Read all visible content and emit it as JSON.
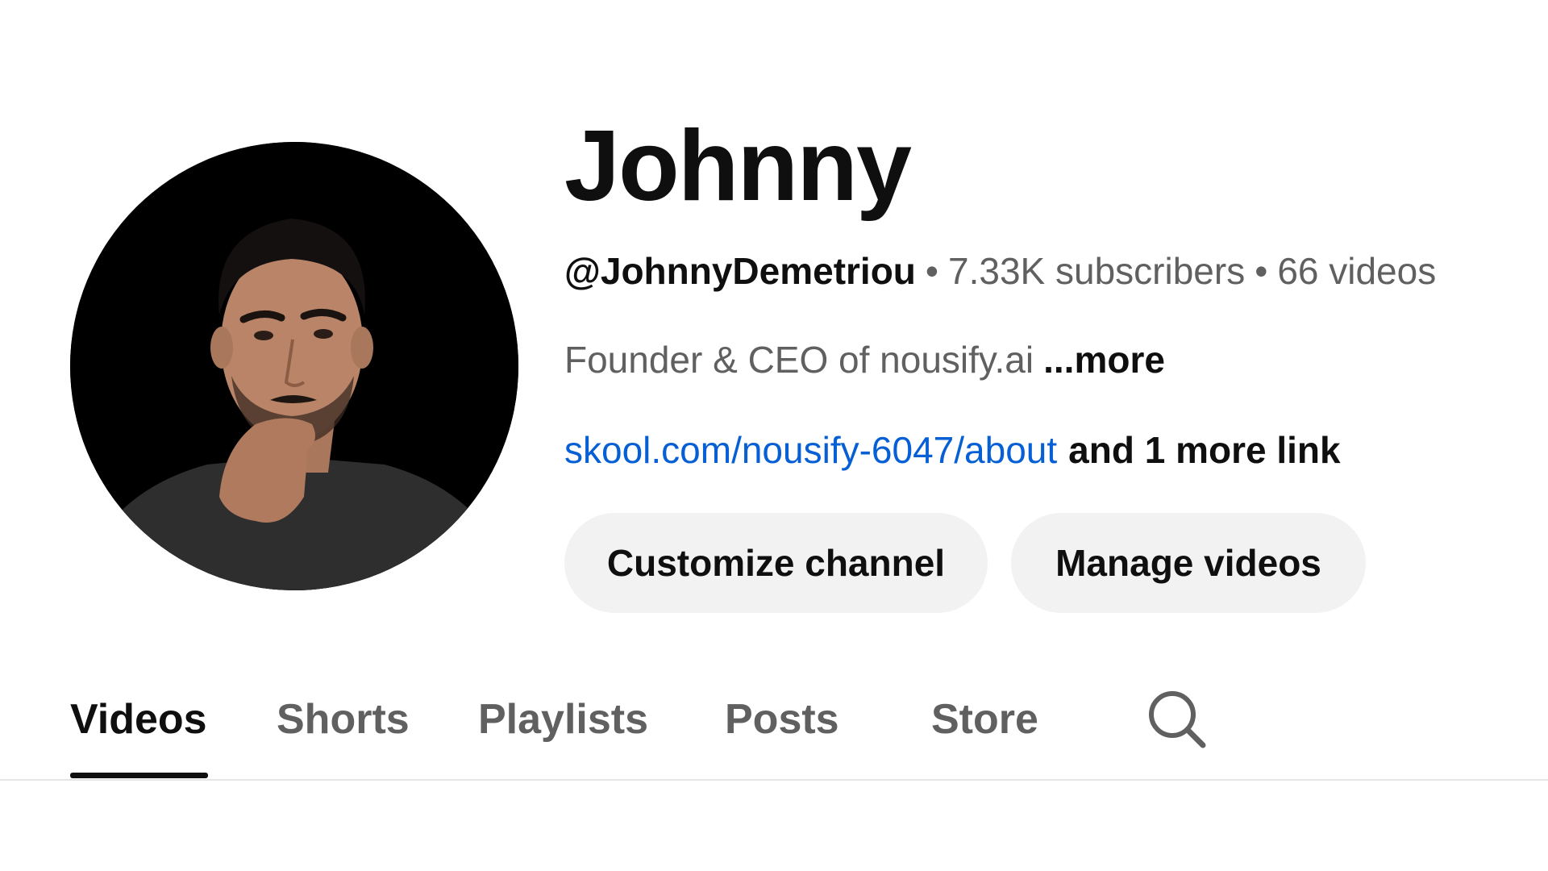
{
  "channel": {
    "name": "Johnny",
    "handle": "@JohnnyDemetriou",
    "separator": "•",
    "subscribers": "7.33K subscribers",
    "videos": "66 videos",
    "description": "Founder & CEO of nousify.ai",
    "more_label": "...more",
    "link": "skool.com/nousify-6047/about",
    "more_links": "and 1 more link"
  },
  "actions": {
    "customize_label": "Customize channel",
    "manage_label": "Manage videos"
  },
  "tabs": [
    {
      "label": "Videos",
      "active": true
    },
    {
      "label": "Shorts",
      "active": false
    },
    {
      "label": "Playlists",
      "active": false
    },
    {
      "label": "Posts",
      "active": false
    },
    {
      "label": "Store",
      "active": false
    }
  ],
  "icons": {
    "search": "search-icon"
  },
  "colors": {
    "link": "#065fd4",
    "button_bg": "#f2f2f2",
    "secondary_text": "#606060",
    "primary_text": "#0f0f0f"
  }
}
